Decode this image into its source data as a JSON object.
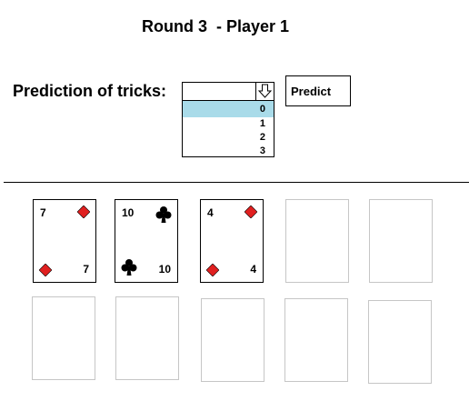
{
  "header": {
    "title": "Round 3  - Player 1"
  },
  "prediction": {
    "label": "Prediction of tricks:",
    "current_value": "",
    "options": [
      "0",
      "1",
      "2",
      "3"
    ],
    "selected_option": "0",
    "button_label": "Predict"
  },
  "hand": [
    {
      "rank": "7",
      "suit": "diamonds",
      "color": "#e02020"
    },
    {
      "rank": "10",
      "suit": "clubs",
      "color": "#000000"
    },
    {
      "rank": "4",
      "suit": "diamonds",
      "color": "#e02020"
    }
  ],
  "colors": {
    "dropdown_highlight": "#a9dbe9",
    "empty_slot_border": "#c6c6c6"
  }
}
